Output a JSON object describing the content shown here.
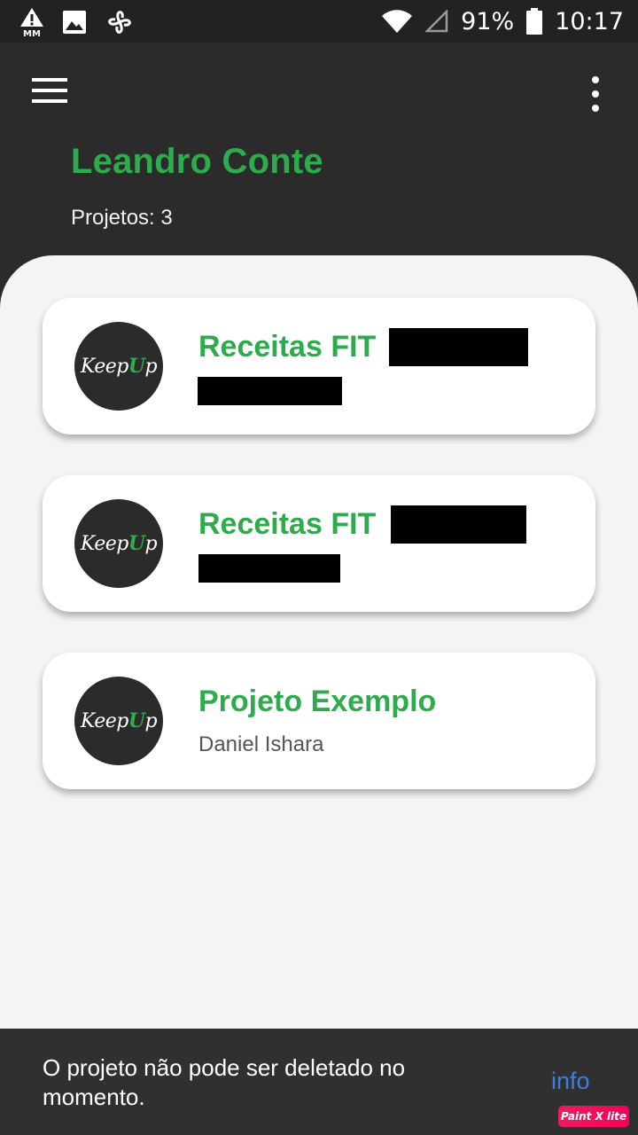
{
  "status_bar": {
    "left_icons": [
      "alert-mm-icon",
      "image-icon",
      "fan-icon"
    ],
    "mm_label": "MM",
    "battery_percent": "91%",
    "time": "10:17"
  },
  "header": {
    "user_name": "Leandro Conte",
    "projects_label": "Projetos: ",
    "projects_count": "3"
  },
  "projects": [
    {
      "title": "Receitas FIT",
      "subtitle": "",
      "logo_text_a": "Keep",
      "logo_text_u": "U",
      "logo_text_b": "p"
    },
    {
      "title": "Receitas FIT",
      "subtitle": "",
      "logo_text_a": "Keep",
      "logo_text_u": "U",
      "logo_text_b": "p"
    },
    {
      "title": "Projeto Exemplo",
      "subtitle": "Daniel Ishara",
      "logo_text_a": "Keep",
      "logo_text_u": "U",
      "logo_text_b": "p"
    }
  ],
  "snackbar": {
    "message": "O projeto não pode ser deletado no momento.",
    "action": "info"
  },
  "watermark": "Paint X lite",
  "colors": {
    "accent_green": "#2eab4c",
    "header_bg": "#2b2b2b",
    "snackbar_action": "#3e7ee0"
  }
}
